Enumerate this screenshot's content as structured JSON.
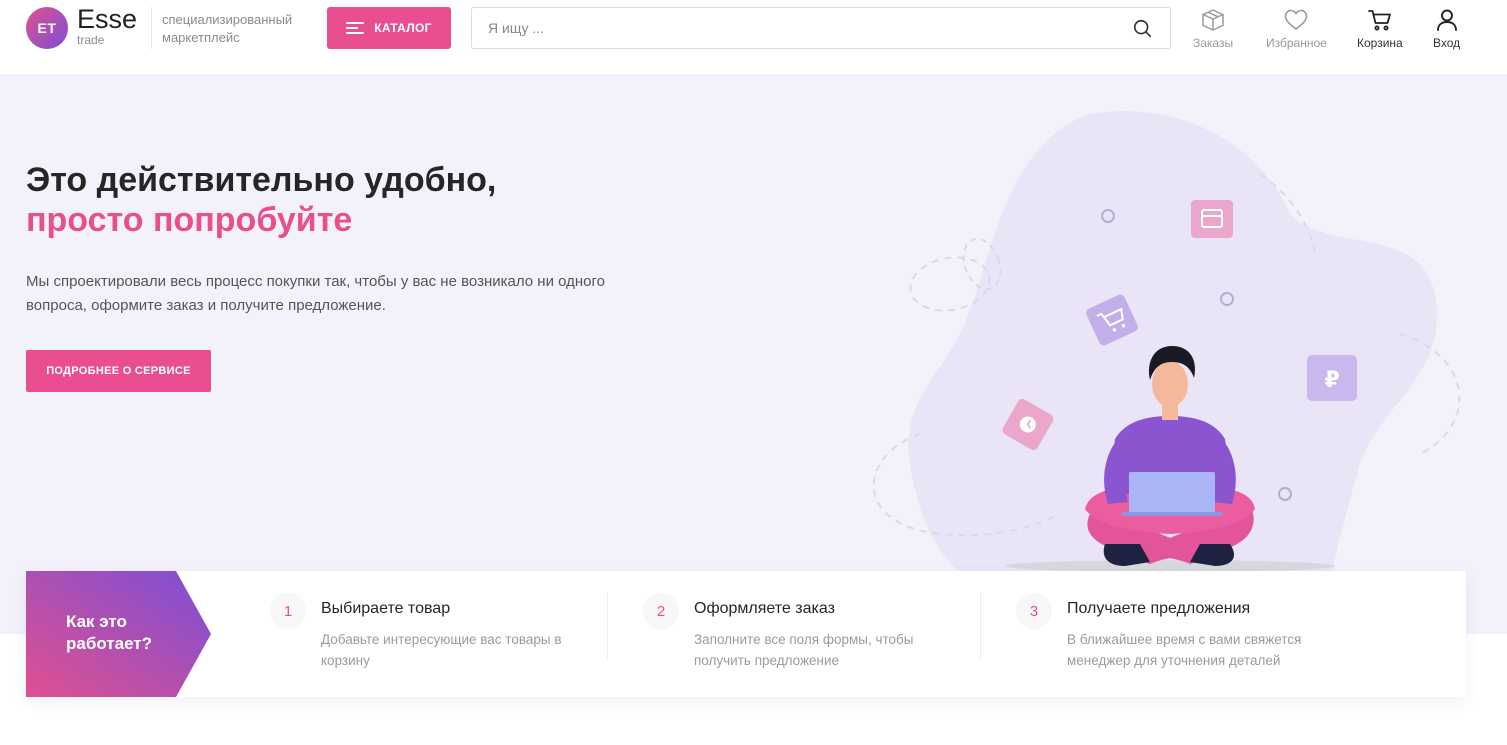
{
  "header": {
    "logo_badge": "ET",
    "logo_name": "Esse",
    "logo_sub": "trade",
    "tagline": "специализированный маркетплейс",
    "catalog_label": "КАТАЛОГ",
    "search_placeholder": "Я ищу ...",
    "nav": {
      "orders": "Заказы",
      "favorites": "Избранное",
      "cart": "Корзина",
      "login": "Вход"
    }
  },
  "hero": {
    "title": "Это действительно удобно,",
    "title_accent": "просто попробуйте",
    "description": "Мы спроектировали весь процесс покупки так, чтобы у вас не возникало ни одного вопроса, оформите заказ и получите предложение.",
    "button_label": "ПОДРОБНЕЕ О СЕРВИСЕ"
  },
  "how_it_works": {
    "title": "Как это работает?",
    "steps": [
      {
        "num": "1",
        "title": "Выбираете товар",
        "desc": "Добавьте интересующие вас товары в корзину"
      },
      {
        "num": "2",
        "title": "Оформляете заказ",
        "desc": "Заполните все поля формы, чтобы получить предложение"
      },
      {
        "num": "3",
        "title": "Получаете предложения",
        "desc": "В ближайшее время с вами свяжется менеджер для уточнения деталей"
      }
    ]
  },
  "icons": {
    "search": "search-icon",
    "orders": "box-icon",
    "favorites": "heart-icon",
    "cart": "cart-icon",
    "login": "user-icon",
    "menu": "menu-icon"
  },
  "colors": {
    "accent": "#e94f90",
    "purple": "#7b4fd6",
    "hero_bg": "#f3f2fa"
  }
}
